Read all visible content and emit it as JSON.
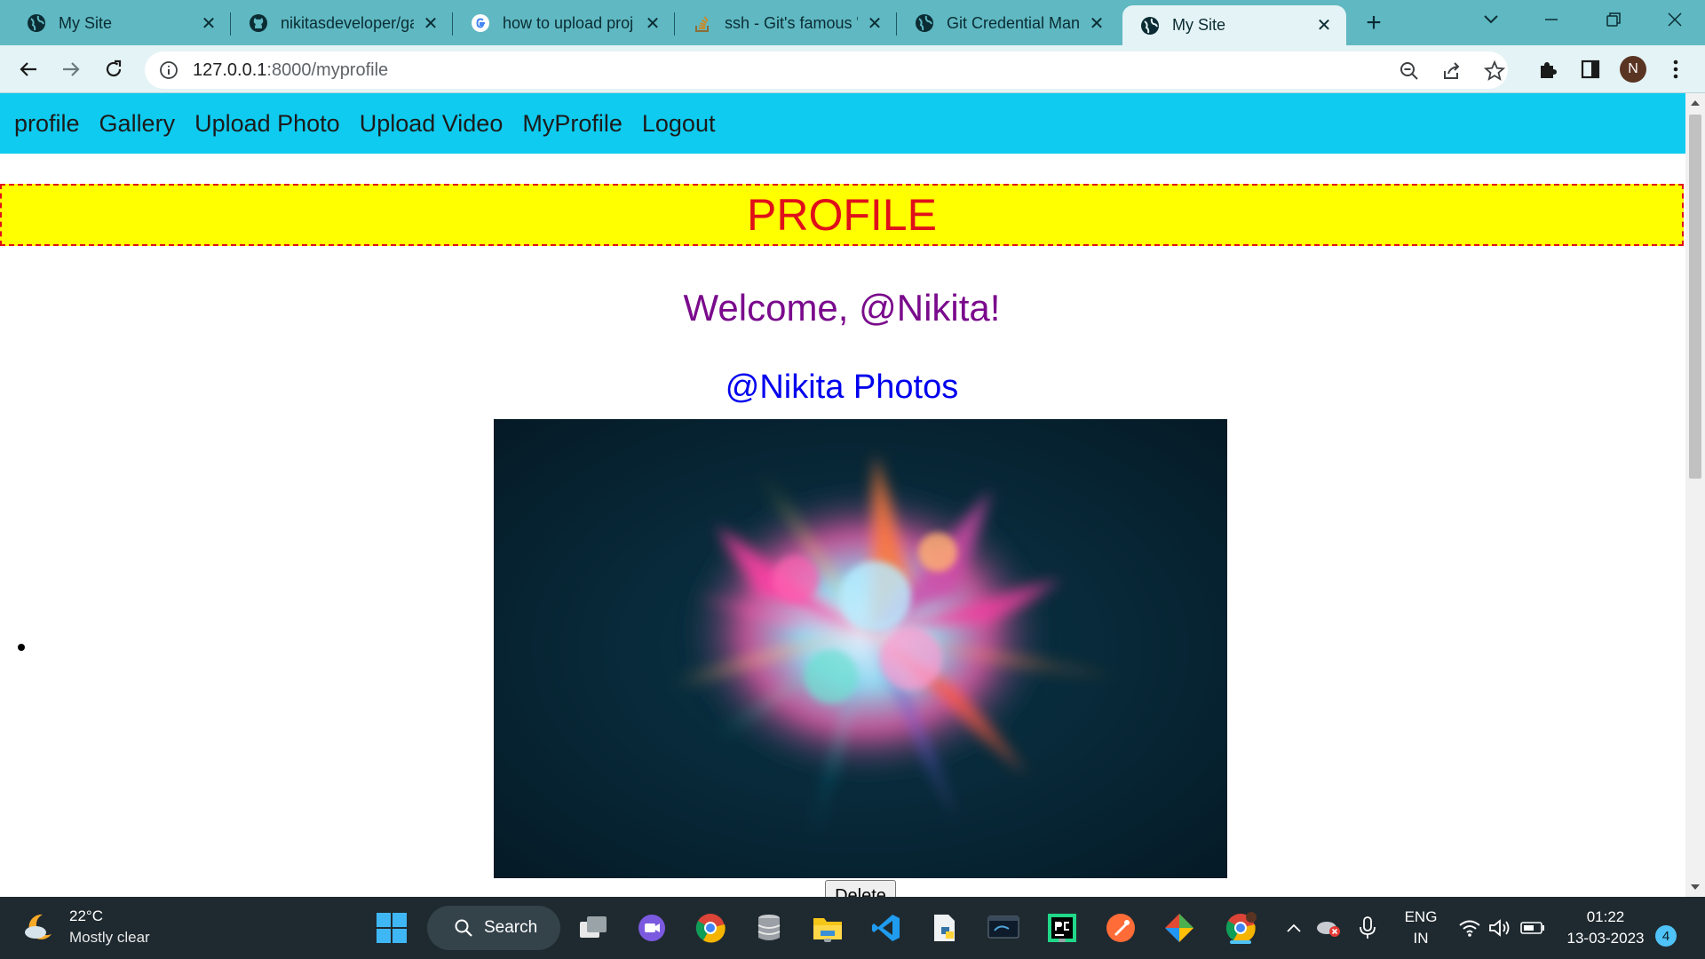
{
  "browser": {
    "tabs": [
      {
        "title": "My Site",
        "icon": "globe-icon"
      },
      {
        "title": "nikitasdeveloper/ga",
        "icon": "github-icon"
      },
      {
        "title": "how to upload proj",
        "icon": "google-icon"
      },
      {
        "title": "ssh - Git's famous \"",
        "icon": "stackoverflow-icon"
      },
      {
        "title": "Git Credential Mana",
        "icon": "globe-icon"
      },
      {
        "title": "My Site",
        "icon": "globe-icon",
        "active": true
      }
    ],
    "url_host": "127.0.0.1",
    "url_path": ":8000/myprofile",
    "profile_initial": "N"
  },
  "site": {
    "nav": [
      "profile",
      "Gallery",
      "Upload Photo",
      "Upload Video",
      "MyProfile",
      "Logout"
    ],
    "banner": "PROFILE",
    "welcome": "Welcome, @Nikita!",
    "photos_title": "@Nikita Photos",
    "delete_label": "Delete"
  },
  "taskbar": {
    "temperature": "22°C",
    "condition": "Mostly clear",
    "search_label": "Search",
    "lang_top": "ENG",
    "lang_bottom": "IN",
    "time": "01:22",
    "date": "13-03-2023",
    "notifications": "4"
  },
  "colors": {
    "nav_bg": "#0fcbf0",
    "banner_bg": "#ffff00",
    "banner_text": "#e0101a",
    "welcome_text": "#7a0a8c",
    "photos_text": "#0000ee",
    "tabstrip_bg": "#5fb8c2",
    "taskbar_bg": "#1f2a30"
  }
}
